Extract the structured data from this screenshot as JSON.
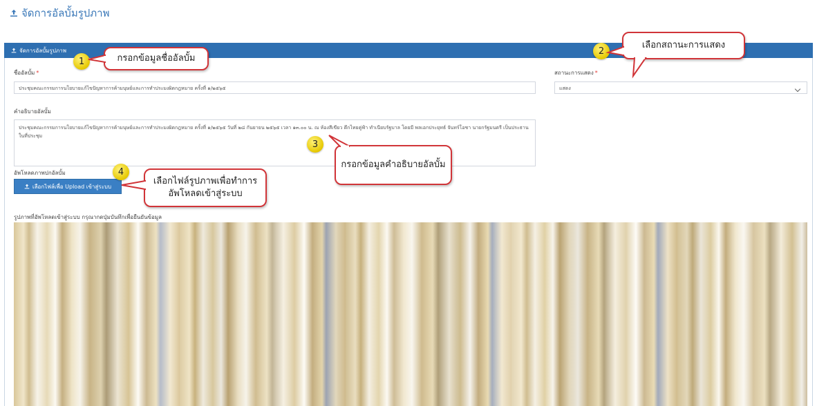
{
  "page": {
    "title": "จัดการอัลบั้มรูปภาพ"
  },
  "panel": {
    "header_title": "จัดการอัลบั้มรูปภาพ"
  },
  "form": {
    "album_name_label": "ชื่ออัลบั้ม",
    "album_name_value": "ประชุมคณะกรรมการนโยบายแก้ไขปัญหาการค้ามนุษย์และการทำประมงผิดกฎหมาย ครั้งที่ ๑/๒๕๖๕",
    "status_label": "สถานะการแสดง",
    "status_value": "แสดง",
    "description_label": "คำอธิบายอัลบั้ม",
    "description_value": "ประชุมคณะกรรมการนโยบายแก้ไขปัญหาการค้ามนุษย์และการทำประมงผิดกฎหมาย ครั้งที่ ๑/๒๕๖๕ วันที่ ๒๘ กันยายน ๒๕๖๕ เวลา ๑๓.๐๐ น. ณ ห้องสีเขียว ตึกไทยคู่ฟ้า ทำเนียบรัฐบาล โดยมี พลเอกประยุทธ์ จันทร์โอชา นายกรัฐมนตรี เป็นประธานในที่ประชุม",
    "cover_upload_label": "อัพโหลดภาพปกอัลบั้ม",
    "upload_button_label": "เลือกไฟล์เพื่อ Upload เข้าสู่ระบบ",
    "uploaded_images_label": "รูปภาพที่อัพโหลดเข้าสู่ระบบ กรุณากดปุ่มบันทึกเพื่อยืนยันข้อมูล",
    "required_mark": "*"
  },
  "callouts": [
    {
      "number": "1",
      "text": "กรอกข้อมูลชื่ออัลบั้ม"
    },
    {
      "number": "2",
      "text": "เลือกสถานะการแสดง"
    },
    {
      "number": "3",
      "text": "กรอกข้อมูลคำอธิบายอัลบั้ม"
    },
    {
      "number": "4",
      "text": "เลือกไฟล์รูปภาพเพื่อทำการอัพโหลดเข้าสู่ระบบ"
    }
  ],
  "colors": {
    "accent": "#2e6fb1",
    "callout_border": "#d13438",
    "badge": "#f2dc1c",
    "required": "#e53935"
  },
  "icons": {
    "title_icon": "upload-icon",
    "button_icon": "upload-icon",
    "select_icon": "chevron-down-icon"
  }
}
